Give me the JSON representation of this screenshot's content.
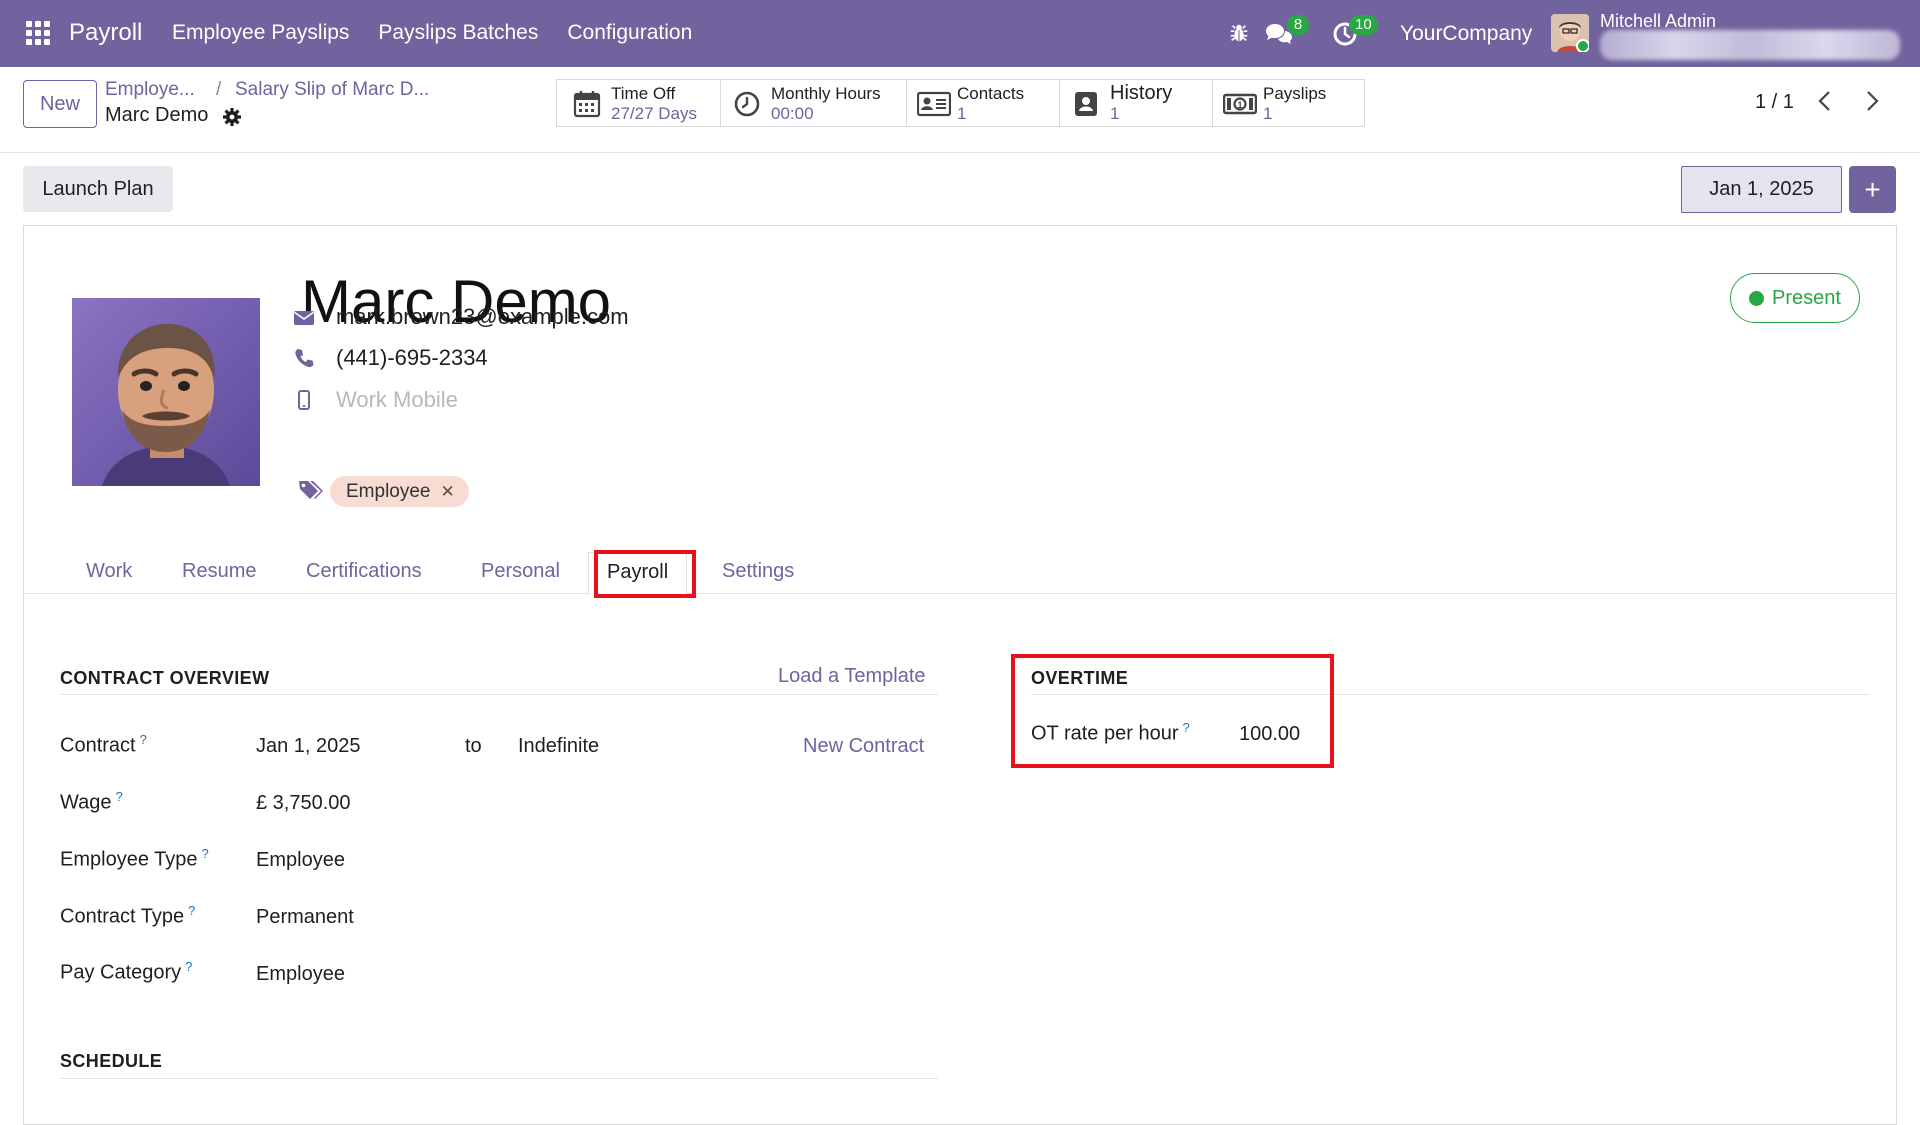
{
  "navbar": {
    "app_name": "Payroll",
    "menu": [
      "Employee Payslips",
      "Payslips Batches",
      "Configuration"
    ],
    "chat_count": "8",
    "activity_count": "10",
    "company": "YourCompany",
    "user": "Mitchell Admin"
  },
  "control_panel": {
    "new_label": "New",
    "breadcrumb_1": "Employe...",
    "breadcrumb_sep": "/",
    "breadcrumb_2": "Salary Slip of Marc D...",
    "current_record": "Marc Demo",
    "smart_buttons": [
      {
        "title": "Time Off",
        "value": "27/27 Days",
        "icon": "calendar-icon"
      },
      {
        "title": "Monthly Hours",
        "value": "00:00",
        "icon": "clock-icon"
      },
      {
        "title": "Contacts",
        "value": "1",
        "icon": "contact-card-icon"
      },
      {
        "title": "History",
        "value": "1",
        "icon": "history-icon"
      },
      {
        "title": "Payslips",
        "value": "1",
        "icon": "money-icon"
      }
    ],
    "pager": "1 / 1"
  },
  "statusbar": {
    "launch_plan": "Launch Plan",
    "date": "Jan 1, 2025",
    "plus": "+"
  },
  "employee": {
    "name": "Marc Demo",
    "email": "mark.brown23@example.com",
    "phone": "(441)-695-2334",
    "mobile_placeholder": "Work Mobile",
    "tag": "Employee",
    "status": "Present"
  },
  "tabs": [
    "Work",
    "Resume",
    "Certifications",
    "Personal",
    "Payroll",
    "Settings"
  ],
  "active_tab": "Payroll",
  "contract_overview": {
    "title": "CONTRACT OVERVIEW",
    "load_template": "Load a Template",
    "new_contract": "New Contract",
    "contract_label": "Contract",
    "contract_start": "Jan 1, 2025",
    "to_label": "to",
    "contract_end_placeholder": "Indefinite",
    "wage_label": "Wage",
    "wage_value": "£ 3,750.00",
    "employee_type_label": "Employee Type",
    "employee_type_value": "Employee",
    "contract_type_label": "Contract Type",
    "contract_type_value": "Permanent",
    "pay_category_label": "Pay Category",
    "pay_category_value": "Employee",
    "help_mark": "?"
  },
  "overtime": {
    "title": "OVERTIME",
    "ot_rate_label": "OT rate per hour",
    "ot_rate_value": "100.00"
  },
  "schedule": {
    "title": "SCHEDULE"
  },
  "colors": {
    "brand": "#71639e",
    "success": "#28a745",
    "highlight": "#e8111e"
  }
}
